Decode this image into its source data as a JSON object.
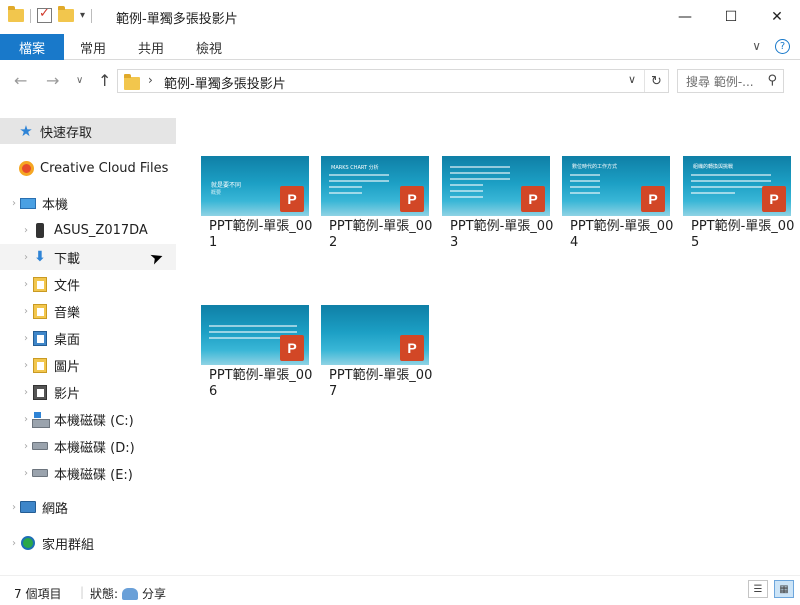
{
  "window": {
    "title": "範例-單獨多張投影片",
    "minimize": "—",
    "maximize": "☐",
    "close": "✕"
  },
  "ribbon": {
    "file_tab": "檔案",
    "tabs": [
      "常用",
      "共用",
      "檢視"
    ],
    "collapse": "∨",
    "help": "?"
  },
  "address": {
    "back": "←",
    "forward": "→",
    "recent": "∨",
    "up": "↑",
    "path_sep": "›",
    "path": "範例-單獨多張投影片",
    "dropdown": "∨",
    "refresh": "↻",
    "search_placeholder": "搜尋 範例-...",
    "search_icon": "⚲"
  },
  "sidebar": {
    "items": [
      {
        "label": "快速存取",
        "icon": "star-icon"
      },
      {
        "label": "Creative Cloud Files",
        "icon": "creative-cloud-icon"
      },
      {
        "label": "本機",
        "icon": "computer-icon"
      },
      {
        "label": "ASUS_Z017DA",
        "icon": "phone-icon"
      },
      {
        "label": "下載",
        "icon": "download-icon"
      },
      {
        "label": "文件",
        "icon": "documents-icon"
      },
      {
        "label": "音樂",
        "icon": "music-icon"
      },
      {
        "label": "桌面",
        "icon": "desktop-icon"
      },
      {
        "label": "圖片",
        "icon": "pictures-icon"
      },
      {
        "label": "影片",
        "icon": "videos-icon"
      },
      {
        "label": "本機磁碟 (C:)",
        "icon": "windows-drive-icon"
      },
      {
        "label": "本機磁碟 (D:)",
        "icon": "drive-icon"
      },
      {
        "label": "本機磁碟 (E:)",
        "icon": "drive-icon"
      },
      {
        "label": "網路",
        "icon": "network-icon"
      },
      {
        "label": "家用群組",
        "icon": "homegroup-icon"
      }
    ],
    "expander": "›"
  },
  "files": [
    {
      "name": "PPT範例-單張_001",
      "slide_title": "就是要不同",
      "slide_sub": "概要"
    },
    {
      "name": "PPT範例-單張_002",
      "slide_title": "MARKS CHART 分析",
      "slide_sub": ""
    },
    {
      "name": "PPT範例-單張_003",
      "slide_title": "",
      "slide_sub": ""
    },
    {
      "name": "PPT範例-單張_004",
      "slide_title": "數位時代的工作方式",
      "slide_sub": ""
    },
    {
      "name": "PPT範例-單張_005",
      "slide_title": "組織的轉換與挑戰",
      "slide_sub": ""
    },
    {
      "name": "PPT範例-單張_006",
      "slide_title": "",
      "slide_sub": ""
    },
    {
      "name": "PPT範例-單張_007",
      "slide_title": "",
      "slide_sub": ""
    }
  ],
  "ppt_badge": "P",
  "status": {
    "count": "7 個項目",
    "state_label": "狀態:",
    "state_value": "分享"
  },
  "colors": {
    "accent": "#1979ca",
    "ppt": "#d24726",
    "thumb": "#1c9fc4"
  }
}
